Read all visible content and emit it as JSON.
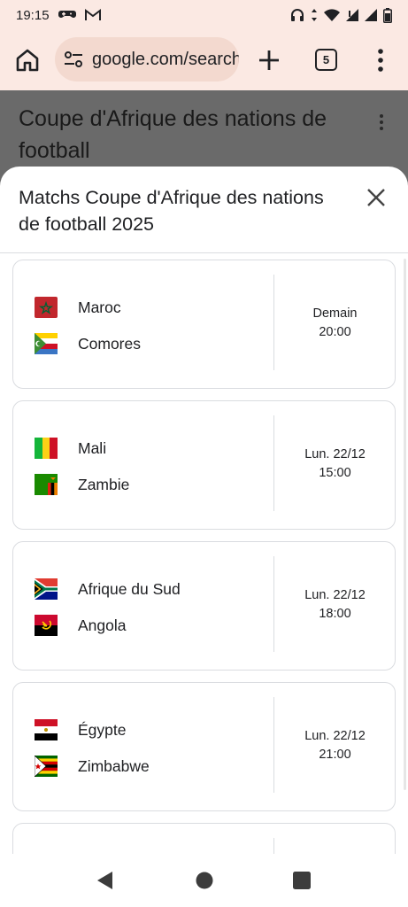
{
  "status_bar": {
    "time": "19:15",
    "left_icons": [
      "gamepad-icon",
      "gmail-icon"
    ],
    "right_icons": [
      "headphones-icon",
      "data-arrows-icon",
      "wifi-icon",
      "signal-alert-icon",
      "signal-icon",
      "battery-icon"
    ]
  },
  "browser": {
    "url": "google.com/search",
    "tab_count": "5"
  },
  "page": {
    "title": "Coupe d'Afrique des nations de football"
  },
  "sheet": {
    "title": "Matchs Coupe d'Afrique des nations de football 2025",
    "matches": [
      {
        "home": "Maroc",
        "away": "Comores",
        "date": "Demain",
        "time": "20:00"
      },
      {
        "home": "Mali",
        "away": "Zambie",
        "date": "Lun. 22/12",
        "time": "15:00"
      },
      {
        "home": "Afrique du Sud",
        "away": "Angola",
        "date": "Lun. 22/12",
        "time": "18:00"
      },
      {
        "home": "Égypte",
        "away": "Zimbabwe",
        "date": "Lun. 22/12",
        "time": "21:00"
      }
    ]
  },
  "colors": {
    "chrome_bg": "#fbe9e3",
    "url_pill_bg": "#f3d9cf",
    "scrim": "#6a6a6a",
    "card_border": "#dadce0"
  },
  "nav_icons": [
    "back-icon",
    "home-circle-icon",
    "recents-icon"
  ]
}
